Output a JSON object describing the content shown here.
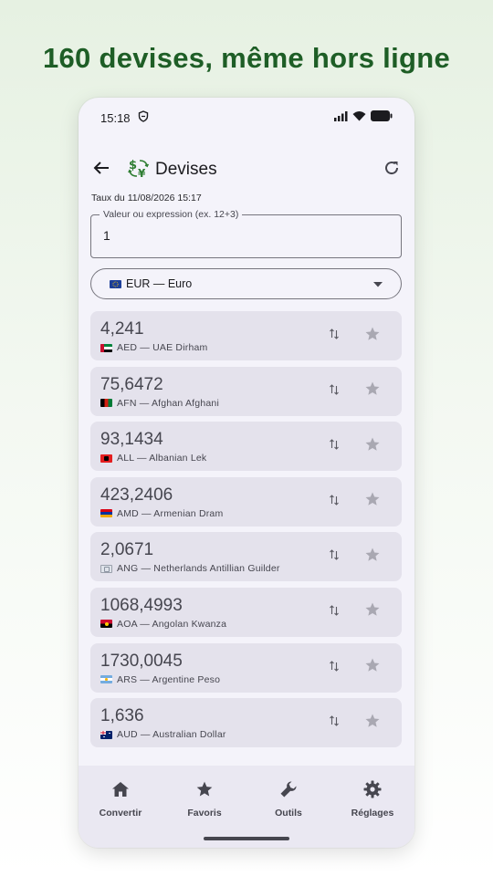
{
  "headline": "160 devises, même hors ligne",
  "status": {
    "time": "15:18"
  },
  "appbar": {
    "title": "Devises",
    "back_icon": "arrow-left-icon",
    "app_icon": "currency-exchange-icon",
    "refresh_icon": "refresh-icon"
  },
  "rate_date": "Taux du 11/08/2026 15:17",
  "value_input": {
    "label": "Valeur ou expression (ex. 12+3)",
    "value": "1"
  },
  "base_currency": {
    "label": "EUR — Euro",
    "flag": "eu"
  },
  "rows": [
    {
      "amount": "4,241",
      "code": "AED — UAE Dirham",
      "flag": "ae"
    },
    {
      "amount": "75,6472",
      "code": "AFN — Afghan Afghani",
      "flag": "af"
    },
    {
      "amount": "93,1434",
      "code": "ALL — Albanian Lek",
      "flag": "al"
    },
    {
      "amount": "423,2406",
      "code": "AMD — Armenian Dram",
      "flag": "am"
    },
    {
      "amount": "2,0671",
      "code": "ANG — Netherlands Antillian Guilder",
      "flag": "an"
    },
    {
      "amount": "1068,4993",
      "code": "AOA — Angolan Kwanza",
      "flag": "ao"
    },
    {
      "amount": "1730,0045",
      "code": "ARS — Argentine Peso",
      "flag": "ar"
    },
    {
      "amount": "1,636",
      "code": "AUD — Australian Dollar",
      "flag": "au"
    }
  ],
  "nav": [
    {
      "label": "Convertir",
      "icon": "home-icon"
    },
    {
      "label": "Favoris",
      "icon": "star-icon"
    },
    {
      "label": "Outils",
      "icon": "wrench-icon"
    },
    {
      "label": "Réglages",
      "icon": "gear-icon"
    }
  ],
  "colors": {
    "headline": "#1e5e26",
    "row_bg": "#e4e2ec",
    "nav_bg": "#eae8f2",
    "phone_bg": "#f4f3fa"
  }
}
